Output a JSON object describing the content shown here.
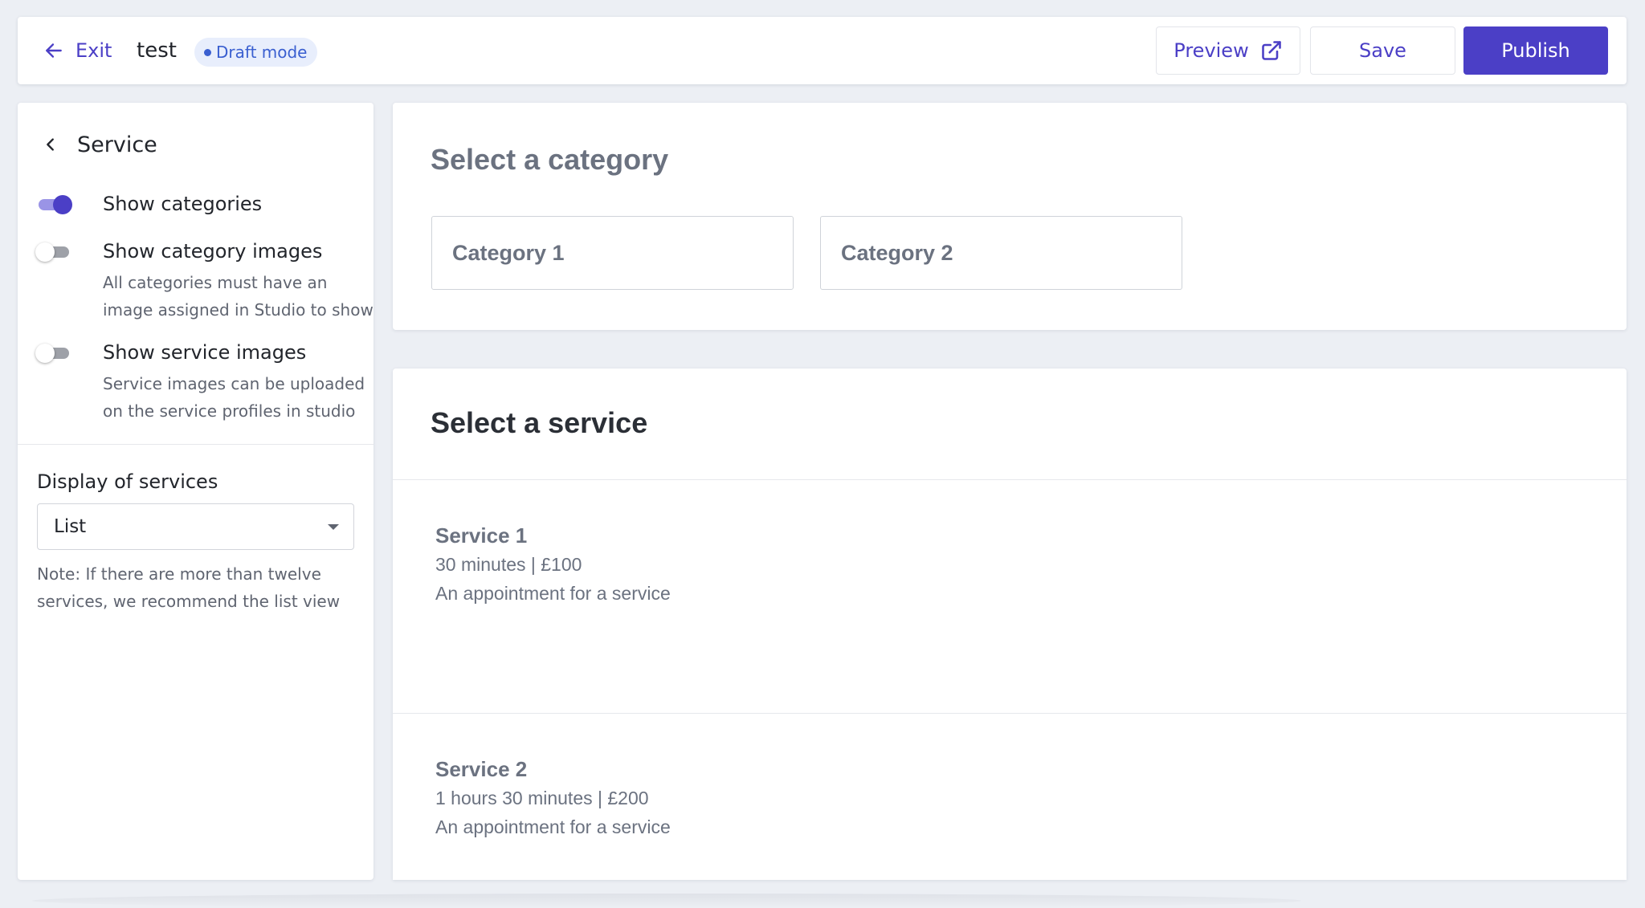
{
  "topbar": {
    "exit_label": "Exit",
    "page_name": "test",
    "status_badge": "Draft mode",
    "preview_label": "Preview",
    "save_label": "Save",
    "publish_label": "Publish"
  },
  "sidebar": {
    "back_title": "Service",
    "toggles": [
      {
        "label": "Show categories",
        "on": true,
        "help": ""
      },
      {
        "label": "Show category images",
        "on": false,
        "help": "All categories must have an image assigned in Studio to show"
      },
      {
        "label": "Show service images",
        "on": false,
        "help": "Service images can be uploaded on the service profiles in studio"
      }
    ],
    "display_label": "Display of services",
    "display_value": "List",
    "display_note": "Note: If there are more than twelve services, we recommend the list view"
  },
  "categories": {
    "title": "Select a category",
    "items": [
      "Category 1",
      "Category 2"
    ]
  },
  "services": {
    "title": "Select a service",
    "items": [
      {
        "name": "Service 1",
        "meta": "30 minutes | £100",
        "description": "An appointment for a service"
      },
      {
        "name": "Service 2",
        "meta": "1 hours 30 minutes | £200",
        "description": "An appointment for a service"
      }
    ]
  },
  "colors": {
    "accent": "#4b3fc6",
    "background": "#eceff4",
    "badge_bg": "#e8eefc",
    "badge_text": "#3a5fd0"
  },
  "icons": {
    "exit": "arrow-left-icon",
    "back": "chevron-left-icon",
    "preview": "external-link-icon",
    "select": "caret-down-icon"
  }
}
